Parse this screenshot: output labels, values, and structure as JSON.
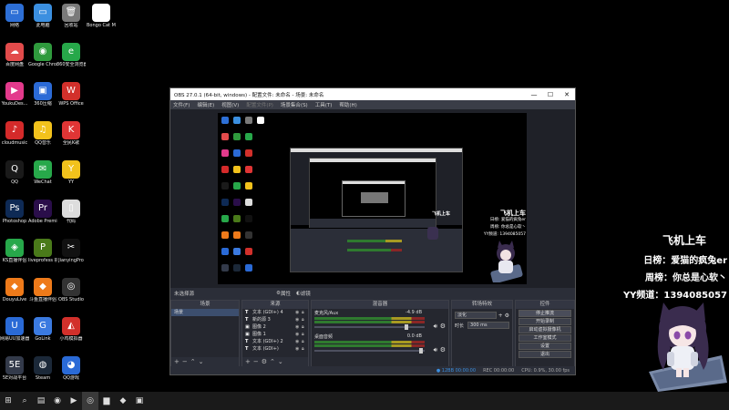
{
  "desktop": {
    "icons": [
      {
        "label": "网络",
        "glyph": "▭",
        "color": "#2d6fd6"
      },
      {
        "label": "此电脑",
        "glyph": "▭",
        "color": "#3b8fe0"
      },
      {
        "label": "回收站",
        "glyph": "🗑",
        "color": "#7a7a7a"
      },
      {
        "label": "Bongo Cat Mver",
        "glyph": "●",
        "color": "#ffffff"
      },
      {
        "label": "百度网盘",
        "glyph": "☁",
        "color": "#e24b4b"
      },
      {
        "label": "Google Chrome",
        "glyph": "◉",
        "color": "#2f9a3d"
      },
      {
        "label": "360安全浏览器",
        "glyph": "e",
        "color": "#27a84a"
      },
      {
        "label": "YoukuDes...",
        "glyph": "▶",
        "color": "#e33a8c"
      },
      {
        "label": "360压缩",
        "glyph": "▣",
        "color": "#2b6ad6"
      },
      {
        "label": "WPS Office",
        "glyph": "W",
        "color": "#d2302b"
      },
      {
        "label": "cloudmusic",
        "glyph": "♪",
        "color": "#d42a2a"
      },
      {
        "label": "QQ音乐",
        "glyph": "♫",
        "color": "#f2c21c"
      },
      {
        "label": "全民K歌",
        "glyph": "K",
        "color": "#e03535"
      },
      {
        "label": "QQ",
        "glyph": "Q",
        "color": "#1a1a1a"
      },
      {
        "label": "WeChat",
        "glyph": "✉",
        "color": "#27a84a"
      },
      {
        "label": "YY",
        "glyph": "Y",
        "color": "#f2c21c"
      },
      {
        "label": "Photoshop",
        "glyph": "Ps",
        "color": "#0e2a55"
      },
      {
        "label": "Adobe Premie...",
        "glyph": "Pr",
        "color": "#2a0e4a"
      },
      {
        "label": "代码",
        "glyph": "▯",
        "color": "#dddddd"
      },
      {
        "label": "KS直播伴侣",
        "glyph": "◈",
        "color": "#27a84a"
      },
      {
        "label": "liveprofess 机器",
        "glyph": "P",
        "color": "#4a7a1a"
      },
      {
        "label": "JianyingPro",
        "glyph": "✂",
        "color": "#111111"
      },
      {
        "label": "DouyuLive",
        "glyph": "◆",
        "color": "#ee7a1a"
      },
      {
        "label": "斗鱼直播伴侣",
        "glyph": "◆",
        "color": "#ee7a1a"
      },
      {
        "label": "OBS Studio",
        "glyph": "◎",
        "color": "#333333"
      },
      {
        "label": "网易UU加速器",
        "glyph": "U",
        "color": "#2a6ad6"
      },
      {
        "label": "GoLink",
        "glyph": "G",
        "color": "#3b7ae0"
      },
      {
        "label": "小鸡模拟器",
        "glyph": "◭",
        "color": "#d2302b"
      },
      {
        "label": "5E对战平台",
        "glyph": "5E",
        "color": "#333a4a"
      },
      {
        "label": "Steam",
        "glyph": "◍",
        "color": "#1b2838"
      },
      {
        "label": "QQ游戏",
        "glyph": "◕",
        "color": "#2a6ad6"
      }
    ]
  },
  "obs": {
    "title": "OBS 27.0.1 (64-bit, windows) - 配置文件: 未命名 - 场景: 未命名",
    "window_controls": [
      "—",
      "☐",
      "✕"
    ],
    "menu": [
      "文件(F)",
      "编辑(E)",
      "视图(V)",
      "配置文件(P)",
      "场景集合(S)",
      "工具(T)",
      "帮助(H)"
    ],
    "preview_overlay": {
      "line1": "飞机上车",
      "line2": "日榜: 爱猫的疯兔er",
      "line3": "周榜: 你总是心软丶",
      "line4": "YY频道: 1394085057"
    },
    "status_row": {
      "no_source": "未选择源",
      "props": "属性",
      "filters": "滤镜"
    },
    "docks": {
      "scenes": {
        "title": "场景",
        "items": [
          "场景"
        ]
      },
      "sources": {
        "title": "来源",
        "items": [
          {
            "type": "T",
            "name": "文本 (GDI+) 4"
          },
          {
            "type": "T",
            "name": "新的源 3"
          },
          {
            "type": "▣",
            "name": "图像 2"
          },
          {
            "type": "▣",
            "name": "图像 1"
          },
          {
            "type": "T",
            "name": "文本 (GDI+) 2"
          },
          {
            "type": "T",
            "name": "文本 (GDI+)"
          }
        ]
      },
      "mixer": {
        "title": "混音器",
        "channels": [
          {
            "name": "麦克风/Aux",
            "db": "-4.9 dB",
            "level": 0.82
          },
          {
            "name": "桌面音频",
            "db": "0.0 dB",
            "level": 0.95
          }
        ]
      },
      "transitions": {
        "title": "转场特效",
        "type": "淡化",
        "duration_label": "时长",
        "duration": "300 ms"
      },
      "controls": {
        "title": "控件",
        "buttons": [
          "停止推流",
          "开始录制",
          "启动虚拟摄像机",
          "工作室模式",
          "设置",
          "退出"
        ]
      }
    },
    "statusbar": {
      "live": "● 12BB 00:00:00",
      "rec": "REC 00:00:00",
      "cpu": "CPU: 0.9%, 30.00 fps"
    }
  },
  "overlay": {
    "line1": "飞机上车",
    "line2": "日榜：爱猫的疯兔er",
    "line3": "周榜：你总是心软丶",
    "line4": "YY频道：1394085057"
  },
  "taskbar": {
    "items": [
      {
        "name": "start-button",
        "glyph": "⊞"
      },
      {
        "name": "search-button",
        "glyph": "⌕"
      },
      {
        "name": "task-view-button",
        "glyph": "▤"
      },
      {
        "name": "taskbar-360-browser",
        "glyph": "◉"
      },
      {
        "name": "taskbar-live",
        "glyph": "▶"
      },
      {
        "name": "taskbar-obs",
        "glyph": "◎"
      },
      {
        "name": "taskbar-folder",
        "glyph": "▆"
      },
      {
        "name": "taskbar-app-orange",
        "glyph": "◆"
      },
      {
        "name": "taskbar-app-red",
        "glyph": "▣"
      }
    ]
  },
  "colors": {
    "accent": "#3c4e6e",
    "meter_green": "#2f7a2f",
    "meter_yellow": "#a89a22",
    "meter_red": "#8a2626"
  }
}
